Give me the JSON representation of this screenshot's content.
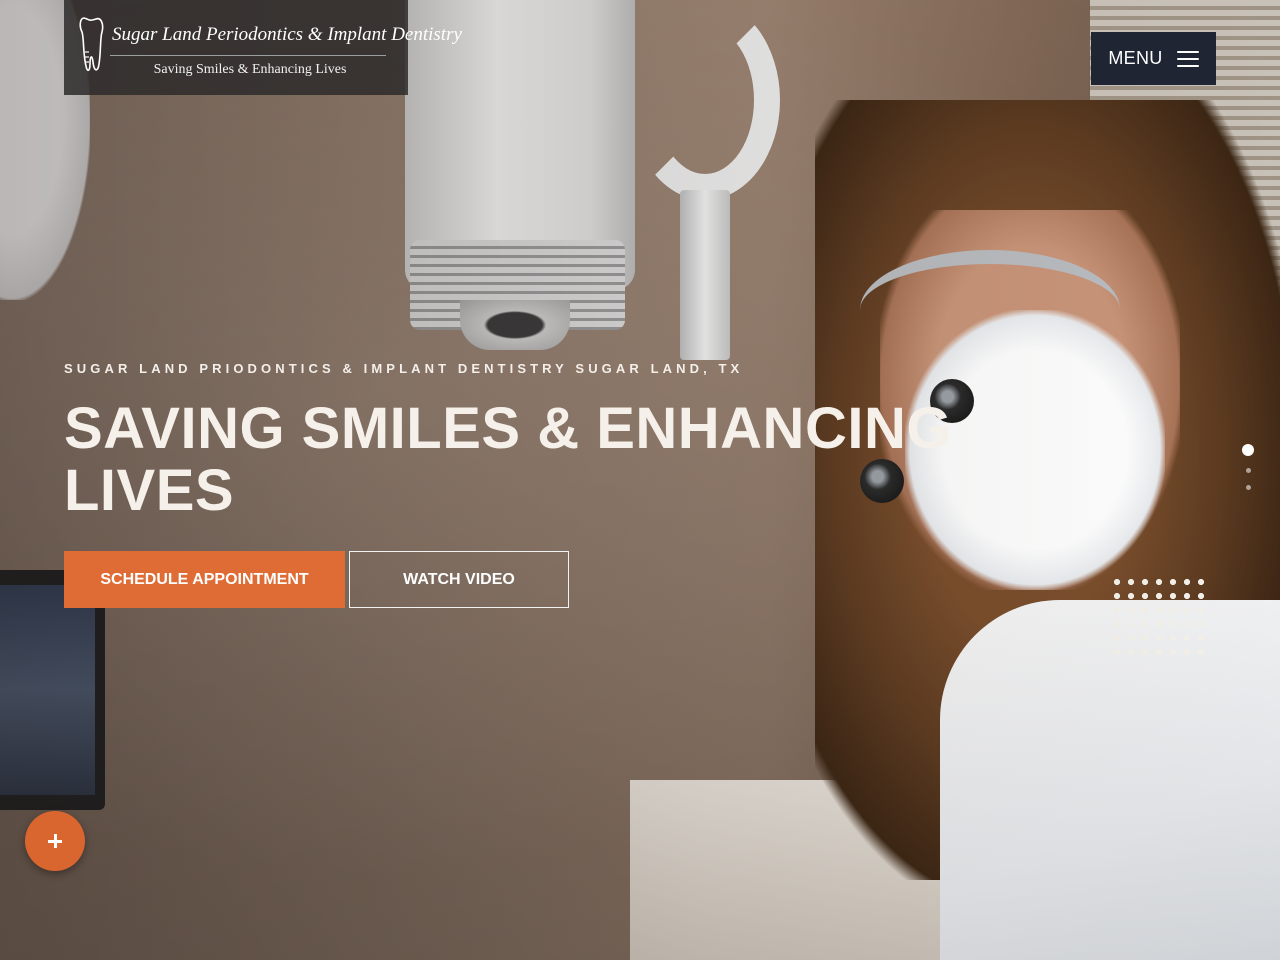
{
  "logo": {
    "title": "Sugar Land Periodontics & Implant Dentistry",
    "tagline": "Saving Smiles & Enhancing Lives",
    "icon": "tooth-icon"
  },
  "header": {
    "menu_label": "MENU",
    "menu_icon": "hamburger-icon"
  },
  "hero": {
    "eyebrow": "SUGAR LAND PRIODONTICS & IMPLANT DENTISTRY SUGAR LAND, TX",
    "headline": "SAVING SMILES & ENHANCING LIVES",
    "primary_cta": "SCHEDULE APPOINTMENT",
    "secondary_cta": "WATCH VIDEO"
  },
  "slider": {
    "total_slides": 3,
    "active_index": 0
  },
  "fab": {
    "icon": "plus-icon"
  },
  "colors": {
    "accent": "#e06c35",
    "menu_bg": "#1f2533",
    "logo_bg": "#2d2a2a"
  }
}
